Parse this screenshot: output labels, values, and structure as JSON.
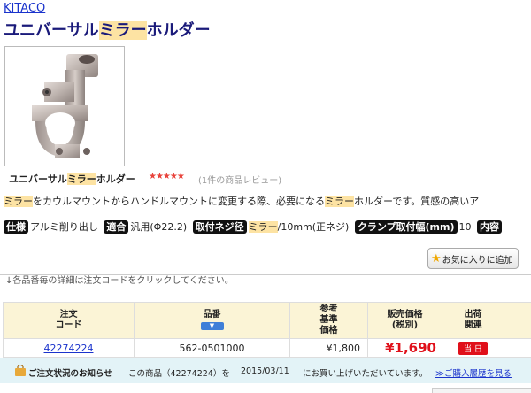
{
  "brand": "KITACO",
  "title": {
    "pre": "ユニバーサル",
    "hl": "ミラー",
    "post": "ホルダー"
  },
  "caption": {
    "pre": "ユニバーサル",
    "hl": "ミラー",
    "post": "ホルダー"
  },
  "rating": {
    "stars": "★★★★★",
    "review_text": "(1件の商品レビュー)"
  },
  "description": {
    "hl1": "ミラー",
    "mid": "をカウルマウントからハンドルマウントに変更する際、必要になる",
    "hl2": "ミラー",
    "post": "ホルダーです。質感の高いア"
  },
  "specs": {
    "spec_tag": "仕様",
    "spec_val": "アルミ削り出し",
    "fit_tag": "適合",
    "fit_val": "汎用(Φ22.2)",
    "thread_tag": "取付ネジ径",
    "thread_hl": "ミラー",
    "thread_val": "/10mm(正ネジ)",
    "clamp_tag": "クランプ取付幅(mm)",
    "clamp_val": "10",
    "contents_tag": "内容"
  },
  "favorite_button": "お気に入りに追加",
  "order_note": "↓各品番毎の詳細は注文コードをクリックしてください。",
  "table": {
    "headers": {
      "code": [
        "注文",
        "コード"
      ],
      "part": "品番",
      "ref": [
        "参考",
        "基準",
        "価格"
      ],
      "sale": [
        "販売価格",
        "(税別)"
      ],
      "ship": [
        "出荷",
        "関連"
      ]
    },
    "sort_label": "▼",
    "rows": [
      {
        "code": "42274224",
        "part": "562-0501000",
        "ref": "¥1,800",
        "price": "¥1,690",
        "ship": "当 日"
      }
    ]
  },
  "status": {
    "label": "ご注文状況のお知らせ",
    "msg1": "この商品（42274224）を",
    "date": "2015/03/11",
    "msg2": "にお買い上げいただいています。",
    "link": "≫ご購入履歴を見る"
  }
}
